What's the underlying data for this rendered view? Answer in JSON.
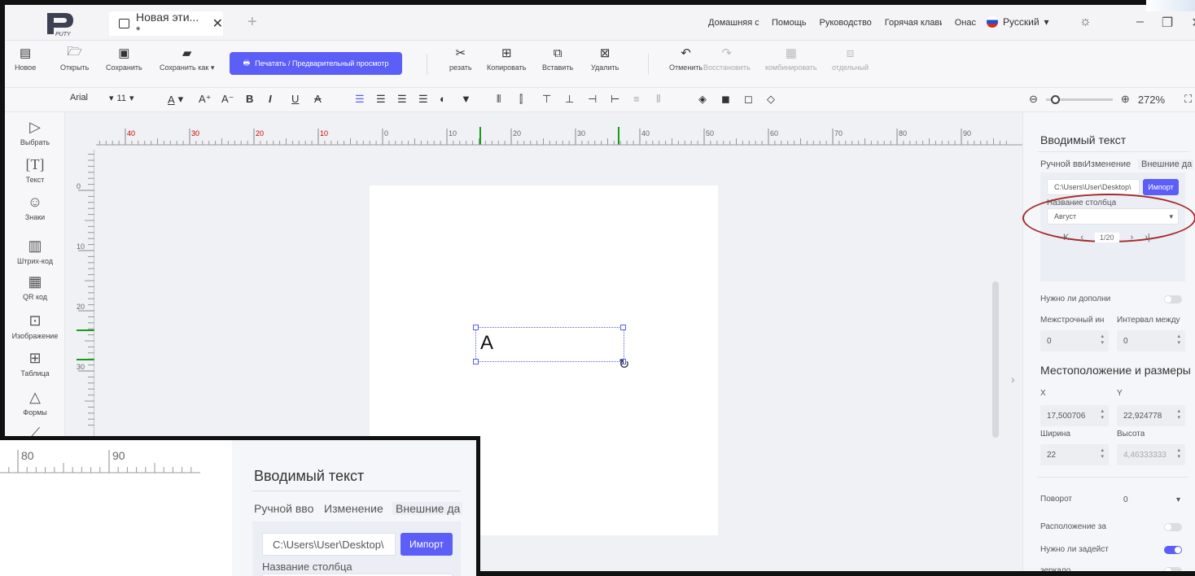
{
  "app": {
    "tab_title": "Новая эти... *",
    "top_links": [
      "Домашняя стра",
      "Помощь",
      "Руководство",
      "Горячая клавиш",
      "Онас"
    ],
    "language": "Русский"
  },
  "toolbar": {
    "new": "Новое",
    "open": "Открыть",
    "save": "Сохранить",
    "save_as": "Сохранить как",
    "print": "Печатать / Предварительный просмотр",
    "cut": "резать",
    "copy": "Копировать",
    "paste": "Вставить",
    "delete": "Удалить",
    "undo": "Отменить",
    "redo": "Восстановить",
    "combine": "комбинировать",
    "separate": "отдельный"
  },
  "format": {
    "font": "Arial",
    "size": "11",
    "zoom": "272%"
  },
  "left_tools": [
    "Выбрать",
    "Текст",
    "Знаки",
    "Штрих-код",
    "QR код",
    "Изображение",
    "Таблица",
    "Формы"
  ],
  "ruler": {
    "h_labels": [
      "40",
      "30",
      "20",
      "10",
      "0",
      "10",
      "20",
      "30",
      "40",
      "50",
      "60",
      "70",
      "80",
      "90"
    ],
    "v_labels": [
      "0",
      "10",
      "20",
      "30"
    ]
  },
  "canvas": {
    "text": "A"
  },
  "panel": {
    "title": "Вводимый текст",
    "tabs": [
      "Ручной вво",
      "Изменение",
      "Внешние да"
    ],
    "file_path": "C:\\Users\\User\\Desktop\\",
    "import": "Импорт",
    "column_label": "Название столбца",
    "column_value": "Август",
    "page": "1/20",
    "need_add": "Нужно ли дополни",
    "line_spacing": "Межстрочный ин",
    "char_spacing": "Интервал между",
    "line_spacing_value": "0",
    "char_spacing_value": "0",
    "pos_title": "Местоположение и размеры",
    "x_label": "X",
    "y_label": "Y",
    "x_value": "17,500706",
    "y_value": "22,924778",
    "w_label": "Ширина",
    "h_label": "Высота",
    "w_value": "22",
    "h_value": "4,46333333",
    "rotation_label": "Поворот",
    "rotation_value": "0",
    "layout_label": "Расположение за",
    "need_use": "Нужно ли задейст",
    "mirror": "зеркало"
  },
  "inset": {
    "ruler_labels": [
      "80",
      "90"
    ],
    "title": "Вводимый текст",
    "tabs": [
      "Ручной вво",
      "Изменение",
      "Внешние да"
    ],
    "file_path": "C:\\Users\\User\\Desktop\\",
    "import": "Импорт",
    "column_label": "Название столбца"
  },
  "colors": {
    "accent": "#5b5ef7",
    "highlight_oval": "#a52a2a"
  }
}
